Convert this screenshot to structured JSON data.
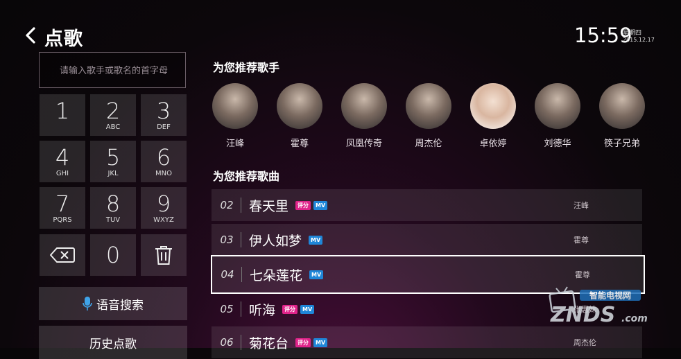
{
  "header": {
    "title": "点歌",
    "time": "15:59",
    "weekday": "星期四",
    "date": "2015.12.17"
  },
  "search": {
    "placeholder": "请输入歌手或歌名的首字母"
  },
  "keypad": [
    {
      "num": "1",
      "letters": ""
    },
    {
      "num": "2",
      "letters": "ABC"
    },
    {
      "num": "3",
      "letters": "DEF"
    },
    {
      "num": "4",
      "letters": "GHI"
    },
    {
      "num": "5",
      "letters": "JKL"
    },
    {
      "num": "6",
      "letters": "MNO"
    },
    {
      "num": "7",
      "letters": "PQRS"
    },
    {
      "num": "8",
      "letters": "TUV"
    },
    {
      "num": "9",
      "letters": "WXYZ"
    },
    {
      "num": "",
      "letters": "",
      "icon": "backspace-icon"
    },
    {
      "num": "0",
      "letters": ""
    },
    {
      "num": "",
      "letters": "",
      "icon": "trash-icon"
    }
  ],
  "buttons": {
    "voice_search": "语音搜索",
    "history": "历史点歌"
  },
  "recommended_singers": {
    "title": "为您推荐歌手",
    "items": [
      {
        "name": "汪峰"
      },
      {
        "name": "霍尊"
      },
      {
        "name": "凤凰传奇"
      },
      {
        "name": "周杰伦"
      },
      {
        "name": "卓依婷"
      },
      {
        "name": "刘德华"
      },
      {
        "name": "筷子兄弟"
      }
    ]
  },
  "recommended_songs": {
    "title": "为您推荐歌曲",
    "items": [
      {
        "no": "02",
        "title": "春天里",
        "score_badge": "评分",
        "mv_badge": "MV",
        "artist": "汪峰"
      },
      {
        "no": "03",
        "title": "伊人如梦",
        "score_badge": "",
        "mv_badge": "MV",
        "artist": "霍尊"
      },
      {
        "no": "04",
        "title": "七朵莲花",
        "score_badge": "",
        "mv_badge": "MV",
        "artist": "霍尊"
      },
      {
        "no": "05",
        "title": "听海",
        "score_badge": "评分",
        "mv_badge": "MV",
        "artist": "张惠妹"
      },
      {
        "no": "06",
        "title": "菊花台",
        "score_badge": "评分",
        "mv_badge": "MV",
        "artist": "周杰伦"
      }
    ]
  },
  "watermark": {
    "brand": "ZNDS",
    "domain": ".com",
    "tagline": "智能电视网"
  },
  "colors": {
    "score_badge": "#e0238a",
    "mv_badge": "#1f86d8",
    "focus_border": "#ffffff",
    "mic_icon": "#3fa3e8"
  }
}
